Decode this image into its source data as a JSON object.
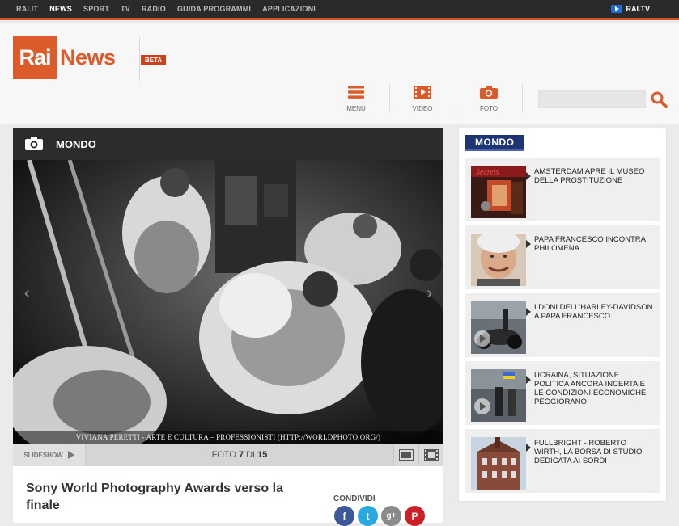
{
  "topnav": {
    "items": [
      "RAI.IT",
      "NEWS",
      "SPORT",
      "TV",
      "RADIO",
      "GUIDA PROGRAMMI",
      "APPLICAZIONI"
    ],
    "active": "NEWS",
    "raitv_label": "RAI.TV"
  },
  "header": {
    "logo_rai": "Rai",
    "logo_news": "News",
    "beta": "BETA",
    "nav": {
      "menu": "MENÙ",
      "video": "VIDEO",
      "foto": "FOTO"
    },
    "search_placeholder": ""
  },
  "main": {
    "section": "MONDO",
    "photo_caption": "VIVIANA PERETTI - ARTE E CULTURA – PROFESSIONISTI (HTTP://WORLDPHOTO.ORG/)",
    "slideshow_label": "SLIDESHOW",
    "counter": {
      "prefix": "FOTO",
      "current": "7",
      "sep": "DI",
      "total": "15"
    },
    "title": "Sony World Photography Awards verso la finale",
    "share_label": "CONDIVIDI",
    "socials": [
      {
        "name": "facebook",
        "glyph": "f",
        "color": "#3b5998"
      },
      {
        "name": "twitter",
        "glyph": "t",
        "color": "#2aa9e0"
      },
      {
        "name": "google-plus",
        "glyph": "g+",
        "color": "#8a8a8a"
      },
      {
        "name": "pinterest",
        "glyph": "P",
        "color": "#cb2027"
      }
    ]
  },
  "sidebar": {
    "badge": "MONDO",
    "items": [
      {
        "title": "AMSTERDAM APRE IL MUSEO DELLA PROSTITUZIONE",
        "thumb_text": "Secrets"
      },
      {
        "title": "PAPA FRANCESCO INCONTRA PHILOMENA",
        "thumb_text": ""
      },
      {
        "title": "I DONI DELL'HARLEY-DAVIDSON A PAPA FRANCESCO",
        "thumb_text": ""
      },
      {
        "title": "UCRAINA, SITUAZIONE POLITICA ANCORA INCERTA E LE CONDIZIONI ECONOMICHE PEGGIORANO",
        "thumb_text": ""
      },
      {
        "title": "FULLBRIGHT - ROBERTO WIRTH, LA BORSA DI STUDIO DEDICATA AI SORDI",
        "thumb_text": ""
      }
    ]
  },
  "colors": {
    "accent": "#dd5a2b",
    "dark": "#2c2c2c",
    "sidebar_badge": "#1d3573"
  }
}
